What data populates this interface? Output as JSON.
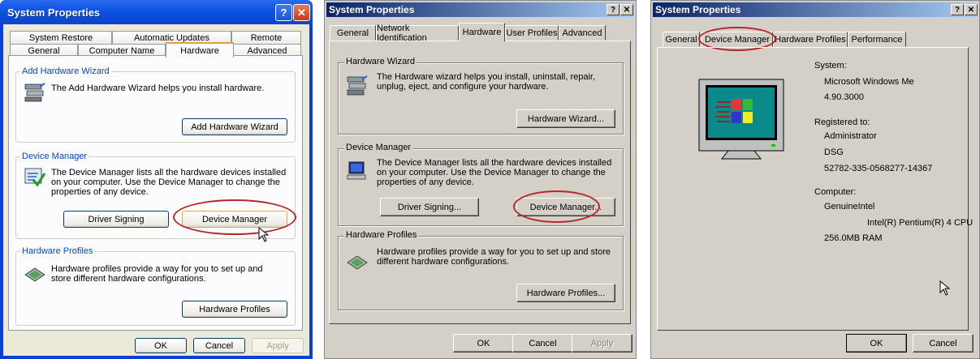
{
  "xp": {
    "title": "System Properties",
    "help": "?",
    "close": "✕",
    "tabs_row1": [
      "System Restore",
      "Automatic Updates",
      "Remote"
    ],
    "tabs_row2": [
      "General",
      "Computer Name",
      "Hardware",
      "Advanced"
    ],
    "wizard": {
      "group": "Add Hardware Wizard",
      "text": "The Add Hardware Wizard helps you install hardware.",
      "button": "Add Hardware Wizard"
    },
    "devmgr": {
      "group": "Device Manager",
      "text": "The Device Manager lists all the hardware devices installed on your computer. Use the Device Manager to change the properties of any device.",
      "driver_button": "Driver Signing",
      "button": "Device Manager"
    },
    "profiles": {
      "group": "Hardware Profiles",
      "text": "Hardware profiles provide a way for you to set up and store different hardware configurations.",
      "button": "Hardware Profiles"
    },
    "ok": "OK",
    "cancel": "Cancel",
    "apply": "Apply"
  },
  "w2k": {
    "title": "System Properties",
    "help": "?",
    "close": "✕",
    "tabs": [
      "General",
      "Network Identification",
      "Hardware",
      "User Profiles",
      "Advanced"
    ],
    "wizard": {
      "group": "Hardware Wizard",
      "text": "The Hardware wizard helps you install, uninstall, repair, unplug, eject, and configure your hardware.",
      "button": "Hardware Wizard..."
    },
    "devmgr": {
      "group": "Device Manager",
      "text": "The Device Manager lists all the hardware devices installed on your computer. Use the Device Manager to change the properties of any device.",
      "driver_button": "Driver Signing...",
      "button": "Device Manager..."
    },
    "profiles": {
      "group": "Hardware Profiles",
      "text": "Hardware profiles provide a way for you to set up and store different hardware configurations.",
      "button": "Hardware Profiles..."
    },
    "ok": "OK",
    "cancel": "Cancel",
    "apply": "Apply"
  },
  "me": {
    "title": "System Properties",
    "help": "?",
    "close": "✕",
    "tabs": [
      "General",
      "Device Manager",
      "Hardware Profiles",
      "Performance"
    ],
    "system_label": "System:",
    "os_name": "Microsoft Windows Me",
    "os_version": "4.90.3000",
    "registered_label": "Registered to:",
    "reg_user": "Administrator",
    "reg_org": "DSG",
    "reg_id": "52782-335-0568277-14367",
    "computer_label": "Computer:",
    "cpu_vendor": "GenuineIntel",
    "cpu_name": "Intel(R) Pentium(R) 4 CPU",
    "ram": "256.0MB RAM",
    "ok": "OK",
    "cancel": "Cancel"
  }
}
